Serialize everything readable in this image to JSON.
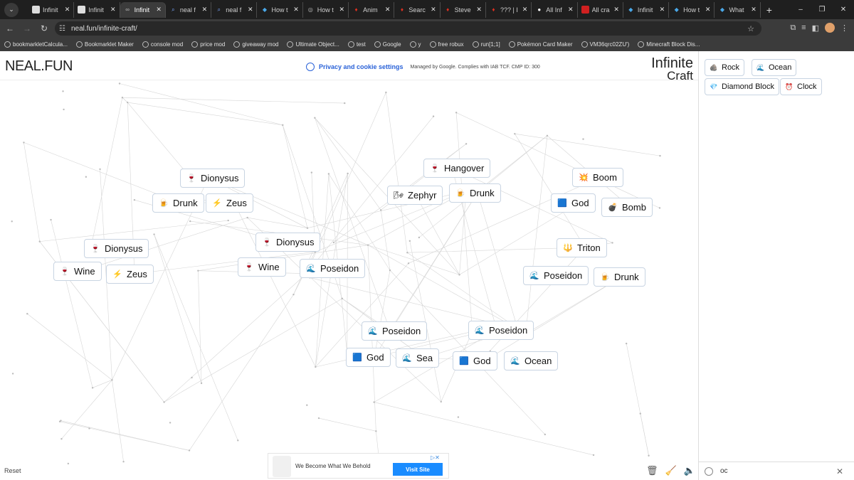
{
  "browser": {
    "tabs": [
      {
        "label": "Infinit",
        "icon": "white-square",
        "active": false
      },
      {
        "label": "Infinit",
        "icon": "white-square",
        "active": false
      },
      {
        "label": "Infinit",
        "icon": "link-icon",
        "active": true
      },
      {
        "label": "neal f",
        "icon": "search-icon",
        "active": false
      },
      {
        "label": "neal f",
        "icon": "search-icon",
        "active": false
      },
      {
        "label": "How t",
        "icon": "cube-icon",
        "active": false
      },
      {
        "label": "How t",
        "icon": "globe-icon",
        "active": false
      },
      {
        "label": "Anim",
        "icon": "flame-icon",
        "active": false
      },
      {
        "label": "Searc",
        "icon": "flame-icon",
        "active": false
      },
      {
        "label": "Steve",
        "icon": "flame-icon",
        "active": false
      },
      {
        "label": "??? | I",
        "icon": "flame-icon",
        "active": false
      },
      {
        "label": "All Inf",
        "icon": "github-icon",
        "active": false
      },
      {
        "label": "All cra",
        "icon": "red-square",
        "active": false
      },
      {
        "label": "Infinit",
        "icon": "cube-icon",
        "active": false
      },
      {
        "label": "How t",
        "icon": "cube-icon",
        "active": false
      },
      {
        "label": "What",
        "icon": "cube-icon",
        "active": false
      }
    ],
    "url": "neal.fun/infinite-craft/",
    "bookmarks": [
      "bookmarkletCalcula...",
      "Bookmarklet Maker",
      "console mod",
      "price mod",
      "giveaway mod",
      "Ultimate Object...",
      "test",
      "Google",
      "y",
      "free robux",
      "run[1;1]",
      "Pokémon Card Maker",
      "VM36qrc02ZU')",
      "Minecraft Block Dis..."
    ]
  },
  "page": {
    "logo": "NEAL.FUN",
    "privacy_link": "Privacy and cookie settings",
    "privacy_note": "Managed by Google. Complies with IAB TCF. CMP ID: 300",
    "game_title_line1": "Infinite",
    "game_title_line2": "Craft",
    "reset_label": "Reset"
  },
  "canvas_items": [
    {
      "label": "Dionysus",
      "icon": "wine-icon"
    },
    {
      "label": "Drunk",
      "icon": "beer-icon"
    },
    {
      "label": "Zeus",
      "icon": "lightning-icon"
    },
    {
      "label": "Dionysus",
      "icon": "wine-icon"
    },
    {
      "label": "Wine",
      "icon": "wine-icon"
    },
    {
      "label": "Zeus",
      "icon": "lightning-icon"
    },
    {
      "label": "Dionysus",
      "icon": "wine-icon"
    },
    {
      "label": "Wine",
      "icon": "wine-icon"
    },
    {
      "label": "Poseidon",
      "icon": "wave-icon"
    },
    {
      "label": "Hangover",
      "icon": "wine-icon"
    },
    {
      "label": "Zephyr",
      "icon": "wind-icon"
    },
    {
      "label": "Drunk",
      "icon": "beer-icon"
    },
    {
      "label": "Boom",
      "icon": "explosion-icon"
    },
    {
      "label": "God",
      "icon": "cube-icon"
    },
    {
      "label": "Bomb",
      "icon": "bomb-icon"
    },
    {
      "label": "Triton",
      "icon": "trident-icon"
    },
    {
      "label": "Poseidon",
      "icon": "wave-icon"
    },
    {
      "label": "Drunk",
      "icon": "beer-icon"
    },
    {
      "label": "Poseidon",
      "icon": "wave-icon"
    },
    {
      "label": "Poseidon",
      "icon": "wave-icon"
    },
    {
      "label": "God",
      "icon": "cube-icon"
    },
    {
      "label": "Sea",
      "icon": "wave-icon"
    },
    {
      "label": "God",
      "icon": "cube-icon"
    },
    {
      "label": "Ocean",
      "icon": "wave-icon"
    }
  ],
  "sidebar_items": [
    {
      "label": "Rock",
      "icon": "rock-icon"
    },
    {
      "label": "Ocean",
      "icon": "wave-icon"
    },
    {
      "label": "Diamond Block",
      "icon": "diamond-icon"
    },
    {
      "label": "Clock",
      "icon": "clock-icon"
    }
  ],
  "search": {
    "value": "oc"
  },
  "ad": {
    "text": "We Become What We Behold",
    "button": "Visit Site"
  }
}
